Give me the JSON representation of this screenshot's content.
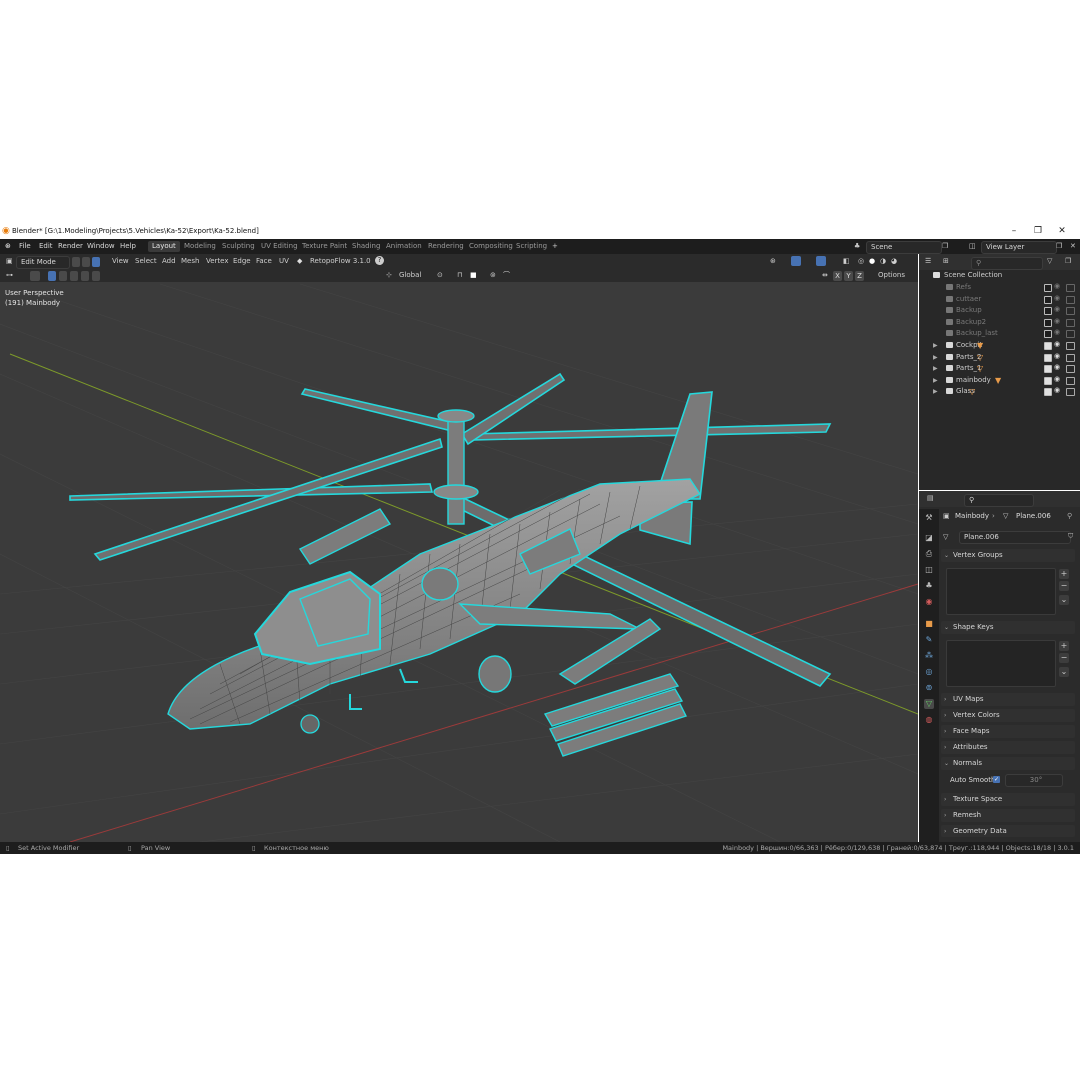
{
  "window": {
    "title": "Blender* [G:\\1.Modeling\\Projects\\5.Vehicles\\Ka-52\\Export\\Ka-52.blend]"
  },
  "menu": [
    "File",
    "Edit",
    "Render",
    "Window",
    "Help"
  ],
  "workspaces": [
    "Layout",
    "Modeling",
    "Sculpting",
    "UV Editing",
    "Texture Paint",
    "Shading",
    "Animation",
    "Rendering",
    "Compositing",
    "Scripting"
  ],
  "workspace_add": "+",
  "scene": {
    "value": "Scene"
  },
  "view_layer": {
    "value": "View Layer"
  },
  "viewport_header": {
    "mode": "Edit Mode",
    "menus": [
      "View",
      "Select",
      "Add",
      "Mesh",
      "Vertex",
      "Edge",
      "Face",
      "UV"
    ],
    "addon": "RetopoFlow 3.1.0",
    "help": "?",
    "orientation": "Global",
    "axes": [
      "X",
      "Y",
      "Z"
    ],
    "options": "Options"
  },
  "viewport_overlay": {
    "perspective": "User Perspective",
    "object": "(191) Mainbody"
  },
  "outliner": {
    "root": "Scene Collection",
    "items": [
      {
        "name": "Refs",
        "dim": true,
        "expand": false,
        "mesh": ""
      },
      {
        "name": "cuttaer",
        "dim": true,
        "expand": false,
        "mesh": ""
      },
      {
        "name": "Backup",
        "dim": true,
        "expand": false,
        "mesh": ""
      },
      {
        "name": "Backup2",
        "dim": true,
        "expand": false,
        "mesh": ""
      },
      {
        "name": "Backup_last",
        "dim": true,
        "expand": false,
        "mesh": ""
      },
      {
        "name": "Cockpit",
        "dim": false,
        "expand": true,
        "mesh": "▼"
      },
      {
        "name": "Parts_2",
        "dim": false,
        "expand": true,
        "mesh": "▽"
      },
      {
        "name": "Parts_1",
        "dim": false,
        "expand": true,
        "mesh": "▽"
      },
      {
        "name": "mainbody",
        "dim": false,
        "expand": true,
        "mesh": "▼"
      },
      {
        "name": "Glass",
        "dim": false,
        "expand": true,
        "mesh": "▽"
      }
    ]
  },
  "properties": {
    "breadcrumb_object": "Mainbody",
    "breadcrumb_data": "Plane.006",
    "datablock": "Plane.006",
    "panels": {
      "vertex_groups": "Vertex Groups",
      "shape_keys": "Shape Keys",
      "uv_maps": "UV Maps",
      "vertex_colors": "Vertex Colors",
      "face_maps": "Face Maps",
      "attributes": "Attributes",
      "normals": "Normals",
      "auto_smooth": "Auto Smooth",
      "auto_smooth_angle": "30°",
      "texture_space": "Texture Space",
      "remesh": "Remesh",
      "geometry_data": "Geometry Data"
    }
  },
  "statusbar": {
    "left": "Set Active Modifier",
    "middle": "Pan View",
    "context": "Контекстное меню",
    "stats": "Mainbody | Вершин:0/66,363 | Рёбер:0/129,638 | Граней:0/63,874 | Треуг.:118,944 | Objects:18/18 | 3.0.1"
  },
  "colors": {
    "accent": "#4772b3",
    "wire": "#25d8dc",
    "mesh_body": "#8a8a8a",
    "grid_x": "#9b3b3b",
    "grid_y": "#7d9a2a"
  }
}
